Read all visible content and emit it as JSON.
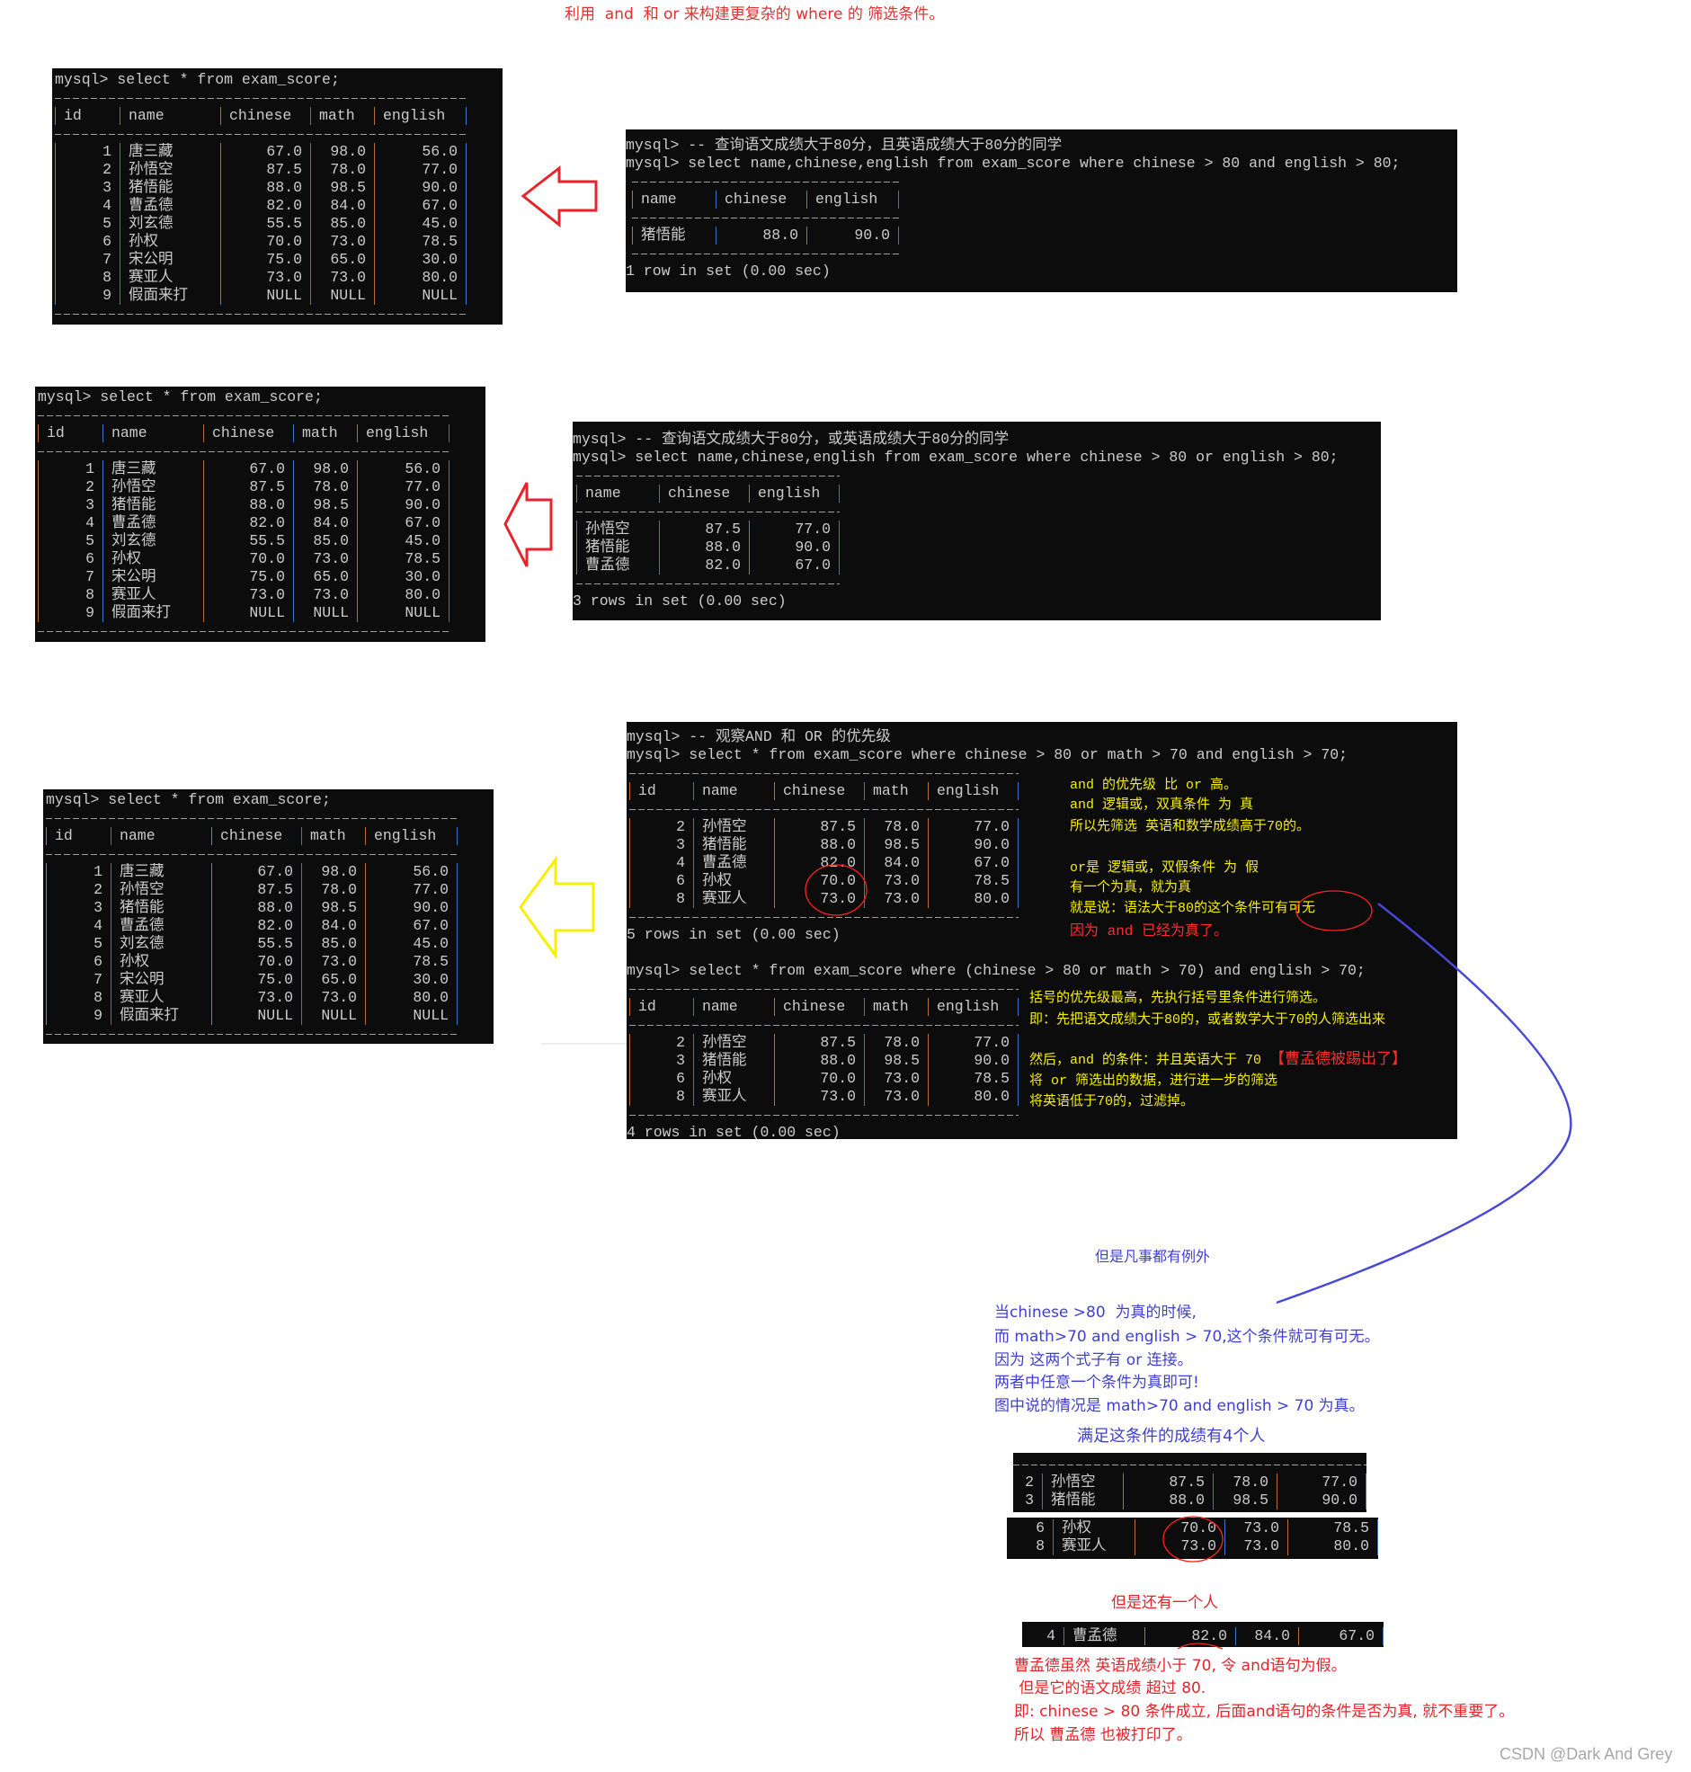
{
  "title": "利用  and  和 or 来构建更复杂的 where 的 筛选条件。",
  "colors": {
    "title": "#e03030",
    "terminal_bg": "#0c0c0c",
    "terminal_text": "#cccccc",
    "note_yellow": "#f5f000",
    "note_red": "#ff2a2a",
    "blue_text": "#4040d0",
    "red_arrow": "#e8232a",
    "yellow_arrow": "#f5f000"
  },
  "icons": [
    "arrow-left-icon-red",
    "arrow-left-icon-red",
    "arrow-left-icon-yellow"
  ],
  "terminals": {
    "t1": {
      "content": [
        {
          "text": "mysql> select * from exam_score;"
        },
        {
          "columns": [
            "id",
            "name",
            "chinese",
            "math",
            "english"
          ],
          "rows": [
            [
              "1",
              "唐三藏",
              "67.0",
              "98.0",
              "56.0"
            ],
            [
              "2",
              "孙悟空",
              "87.5",
              "78.0",
              "77.0"
            ],
            [
              "3",
              "猪悟能",
              "88.0",
              "98.5",
              "90.0"
            ],
            [
              "4",
              "曹孟德",
              "82.0",
              "84.0",
              "67.0"
            ],
            [
              "5",
              "刘玄德",
              "55.5",
              "85.0",
              "45.0"
            ],
            [
              "6",
              "孙权",
              "70.0",
              "73.0",
              "78.5"
            ],
            [
              "7",
              "宋公明",
              "75.0",
              "65.0",
              "30.0"
            ],
            [
              "8",
              "赛亚人",
              "73.0",
              "73.0",
              "80.0"
            ],
            [
              "9",
              "假面来打",
              "NULL",
              "NULL",
              "NULL"
            ]
          ]
        }
      ]
    },
    "r1": {
      "content": [
        {
          "text": "mysql> -- 查询语文成绩大于80分，且英语成绩大于80分的同学"
        },
        {
          "text": "mysql> select name,chinese,english from exam_score where chinese > 80 and english > 80;"
        },
        {
          "columns": [
            "name",
            "chinese",
            "english"
          ],
          "rows": [
            [
              "猪悟能",
              "88.0",
              "90.0"
            ]
          ]
        },
        {
          "text": "1 row in set (0.00 sec)"
        }
      ]
    },
    "t2": {
      "content": [
        {
          "text": "mysql> select * from exam_score;"
        },
        {
          "columns": [
            "id",
            "name",
            "chinese",
            "math",
            "english"
          ],
          "rows": [
            [
              "1",
              "唐三藏",
              "67.0",
              "98.0",
              "56.0"
            ],
            [
              "2",
              "孙悟空",
              "87.5",
              "78.0",
              "77.0"
            ],
            [
              "3",
              "猪悟能",
              "88.0",
              "98.5",
              "90.0"
            ],
            [
              "4",
              "曹孟德",
              "82.0",
              "84.0",
              "67.0"
            ],
            [
              "5",
              "刘玄德",
              "55.5",
              "85.0",
              "45.0"
            ],
            [
              "6",
              "孙权",
              "70.0",
              "73.0",
              "78.5"
            ],
            [
              "7",
              "宋公明",
              "75.0",
              "65.0",
              "30.0"
            ],
            [
              "8",
              "赛亚人",
              "73.0",
              "73.0",
              "80.0"
            ],
            [
              "9",
              "假面来打",
              "NULL",
              "NULL",
              "NULL"
            ]
          ]
        }
      ]
    },
    "r2": {
      "content": [
        {
          "text": "mysql> -- 查询语文成绩大于80分，或英语成绩大于80分的同学"
        },
        {
          "text": "mysql> select name,chinese,english from exam_score where chinese > 80 or english > 80;"
        },
        {
          "columns": [
            "name",
            "chinese",
            "english"
          ],
          "rows": [
            [
              "孙悟空",
              "87.5",
              "77.0"
            ],
            [
              "猪悟能",
              "88.0",
              "90.0"
            ],
            [
              "曹孟德",
              "82.0",
              "67.0"
            ]
          ]
        },
        {
          "text": "3 rows in set (0.00 sec)"
        }
      ]
    },
    "t3": {
      "content": [
        {
          "text": "mysql> select * from exam_score;"
        },
        {
          "columns": [
            "id",
            "name",
            "chinese",
            "math",
            "english"
          ],
          "rows": [
            [
              "1",
              "唐三藏",
              "67.0",
              "98.0",
              "56.0"
            ],
            [
              "2",
              "孙悟空",
              "87.5",
              "78.0",
              "77.0"
            ],
            [
              "3",
              "猪悟能",
              "88.0",
              "98.5",
              "90.0"
            ],
            [
              "4",
              "曹孟德",
              "82.0",
              "84.0",
              "67.0"
            ],
            [
              "5",
              "刘玄德",
              "55.5",
              "85.0",
              "45.0"
            ],
            [
              "6",
              "孙权",
              "70.0",
              "73.0",
              "78.5"
            ],
            [
              "7",
              "宋公明",
              "75.0",
              "65.0",
              "30.0"
            ],
            [
              "8",
              "赛亚人",
              "73.0",
              "73.0",
              "80.0"
            ],
            [
              "9",
              "假面来打",
              "NULL",
              "NULL",
              "NULL"
            ]
          ]
        }
      ]
    },
    "r3": {
      "content": [
        {
          "text": "mysql> -- 观察AND 和 OR 的优先级"
        },
        {
          "text": "mysql> select * from exam_score where chinese > 80 or math > 70 and english > 70;"
        },
        {
          "columns": [
            "id",
            "name",
            "chinese",
            "math",
            "english"
          ],
          "rows": [
            [
              "2",
              "孙悟空",
              "87.5",
              "78.0",
              "77.0"
            ],
            [
              "3",
              "猪悟能",
              "88.0",
              "98.5",
              "90.0"
            ],
            [
              "4",
              "曹孟德",
              "82.0",
              "84.0",
              "67.0"
            ],
            [
              "6",
              "孙权",
              "70.0",
              "73.0",
              "78.5"
            ],
            [
              "8",
              "赛亚人",
              "73.0",
              "73.0",
              "80.0"
            ]
          ]
        },
        {
          "text": "5 rows in set (0.00 sec)"
        },
        {
          "text": ""
        },
        {
          "text": "mysql> select * from exam_score where (chinese > 80 or math > 70) and english > 70;"
        },
        {
          "columns": [
            "id",
            "name",
            "chinese",
            "math",
            "english"
          ],
          "rows": [
            [
              "2",
              "孙悟空",
              "87.5",
              "78.0",
              "77.0"
            ],
            [
              "3",
              "猪悟能",
              "88.0",
              "98.5",
              "90.0"
            ],
            [
              "6",
              "孙权",
              "70.0",
              "73.0",
              "78.5"
            ],
            [
              "8",
              "赛亚人",
              "73.0",
              "73.0",
              "80.0"
            ]
          ]
        },
        {
          "text": "4 rows in set (0.00 sec)"
        }
      ]
    },
    "m1": {
      "content": [
        {
          "rows": [
            [
              "2",
              "孙悟空",
              "87.5",
              "78.0",
              "77.0"
            ],
            [
              "3",
              "猪悟能",
              "88.0",
              "98.5",
              "90.0"
            ]
          ]
        }
      ]
    },
    "m2": {
      "content": [
        {
          "rows": [
            [
              "6",
              "孙权",
              "70.0",
              "73.0",
              "78.5"
            ],
            [
              "8",
              "赛亚人",
              "73.0",
              "73.0",
              "80.0"
            ]
          ]
        }
      ]
    },
    "m3": {
      "content": [
        {
          "rows": [
            [
              "4",
              "曹孟德",
              "82.0",
              "84.0",
              "67.0"
            ]
          ]
        }
      ]
    }
  },
  "r3_notes": {
    "and_priority": "and 的优先级 比 or 高。",
    "and_logic": "and 逻辑或，双真条件 为 真",
    "and_first": "所以先筛选 英语和数学成绩高于70的。",
    "or_logic": "or是 逻辑或，双假条件 为 假",
    "or_one_true": "有一个为真，就为真",
    "optional": "就是说：语法大于80的这个条件可有可无",
    "because": "因为 and 已经为真了。",
    "paren_first": "括号的优先级最高，先执行括号里条件进行筛选。",
    "paren_meaning": "即：先把语文成绩大于80的，或者数学大于70的人筛选出来",
    "then_and": "然后，and 的条件：并且英语大于 70 ",
    "kicked_out": "【曹孟德被踢出了】",
    "further": "将 or 筛选出的数据，进行进一步的筛选",
    "filter": "将英语低于70的，过滤掉。"
  },
  "exception_heading": "但是凡事都有例外",
  "explanation_lines": [
    "当chinese >80  为真的时候,",
    "而 math>70 and english > 70,这个条件就可有可无。",
    "因为 这两个式子有 or 连接。",
    "两者中任意一个条件为真即可!",
    "图中说的情况是 math>70 and english > 70 为真。"
  ],
  "four_people": "满足这条件的成绩有4个人",
  "one_more": "但是还有一个人",
  "conclusion_lines": [
    "曹孟德虽然 英语成绩小于 70, 令 and语句为假。",
    " 但是它的语文成绩 超过 80.",
    "即: chinese > 80 条件成立, 后面and语句的条件是否为真, 就不重要了。",
    "所以 曹孟德 也被打印了。"
  ],
  "watermark": "CSDN @Dark And Grey"
}
